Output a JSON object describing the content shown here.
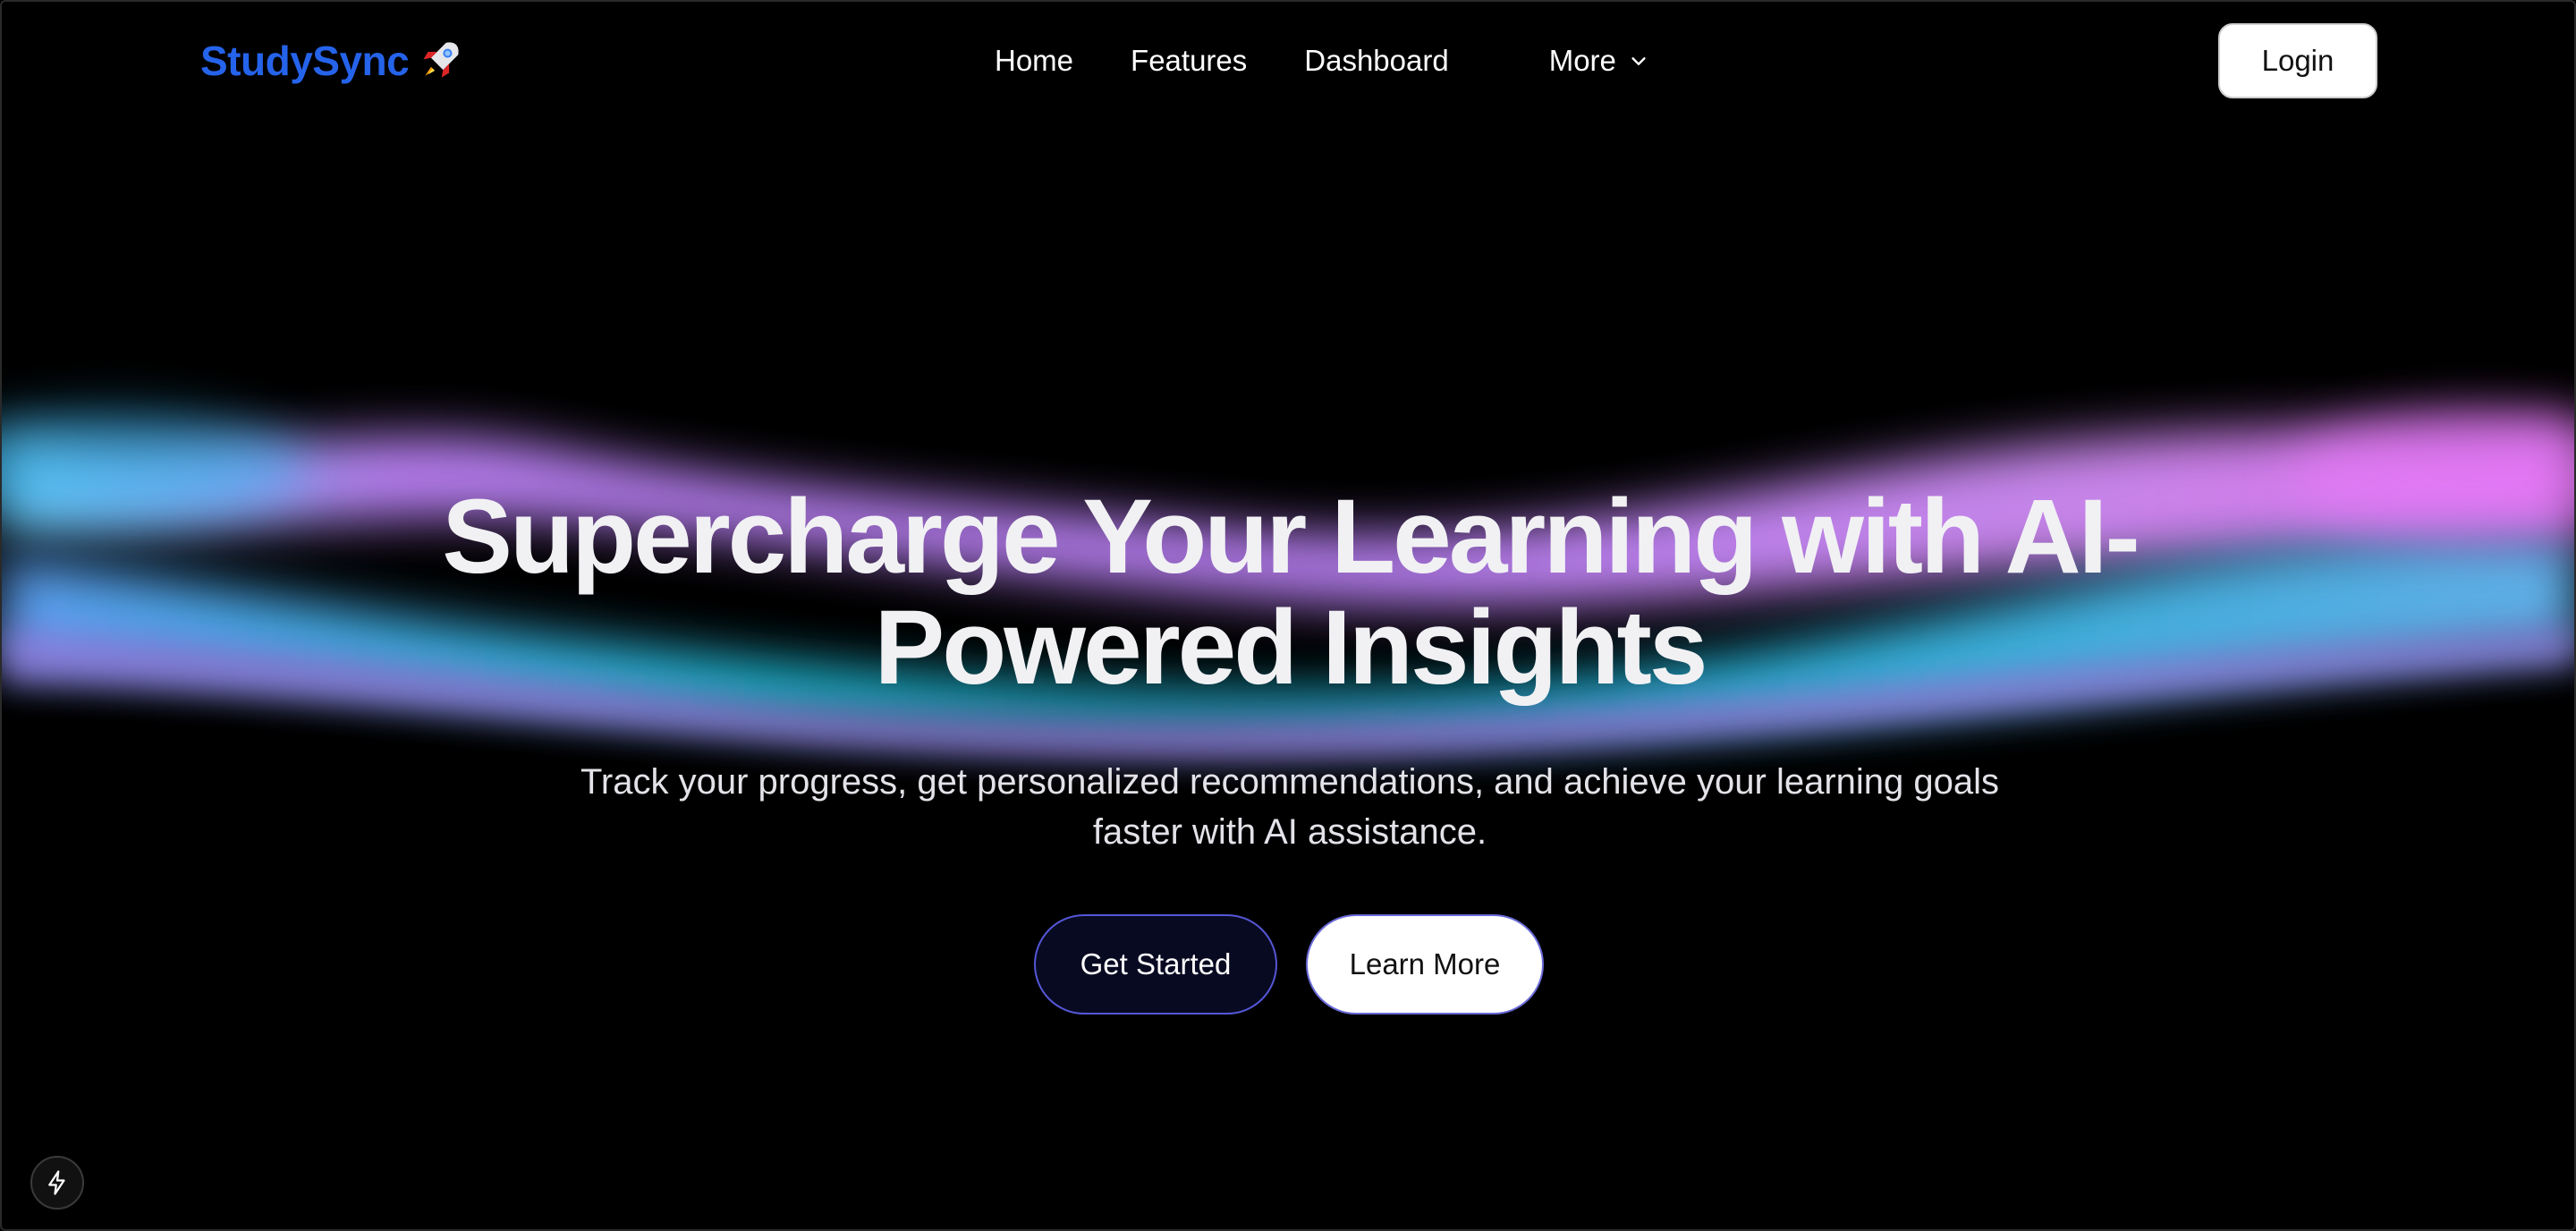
{
  "brand": {
    "name": "StudySync",
    "icon": "rocket-icon",
    "color": "#2563eb"
  },
  "nav": {
    "links": [
      {
        "label": "Home"
      },
      {
        "label": "Features"
      },
      {
        "label": "Dashboard"
      }
    ],
    "more_label": "More",
    "login_label": "Login"
  },
  "hero": {
    "title": "Supercharge Your Learning with AI-Powered Insights",
    "subtitle": "Track your progress, get personalized recommendations, and achieve your learning goals faster with AI assistance.",
    "primary_cta": "Get Started",
    "secondary_cta": "Learn More"
  },
  "floating": {
    "icon": "lightning-icon"
  },
  "colors": {
    "background": "#000000",
    "wave_violet": "#c084fc",
    "wave_cyan": "#22c5e0",
    "wave_blue": "#60a5fa"
  }
}
